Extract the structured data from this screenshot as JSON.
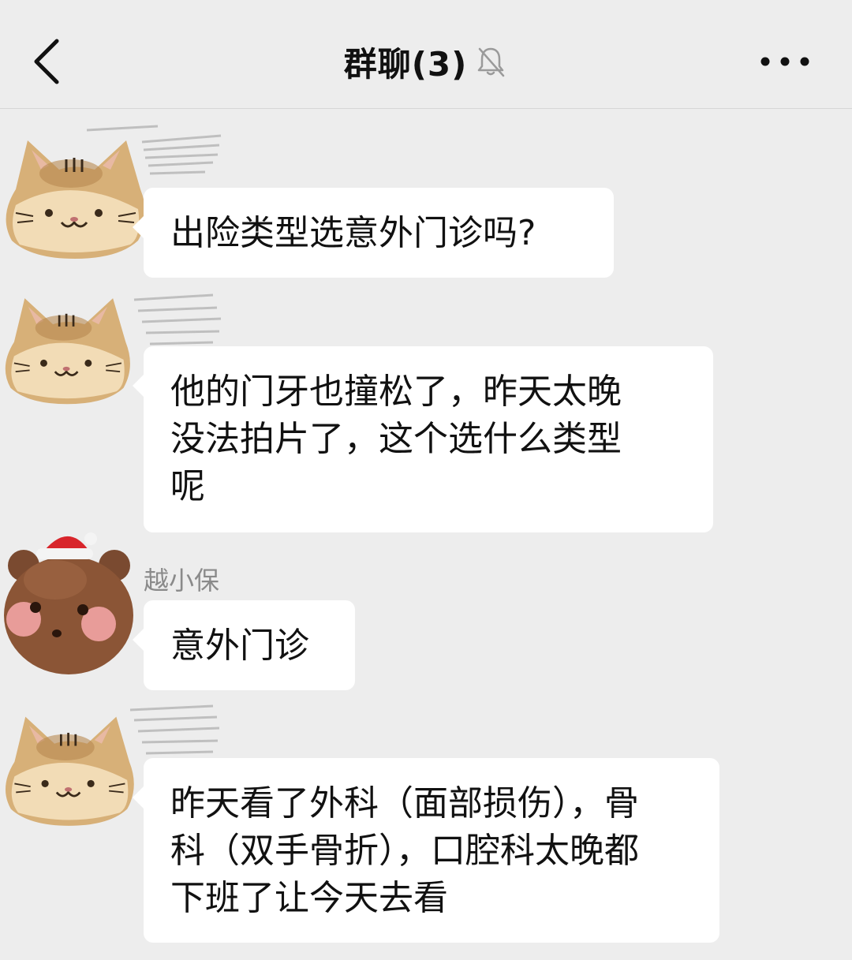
{
  "header": {
    "title": "群聊(3)",
    "back_icon": "chevron-left-icon",
    "mute_icon": "bell-off-icon",
    "more_icon": "more-dots-icon"
  },
  "messages": [
    {
      "sender": "",
      "avatar": "cat-bread-avatar",
      "text": "出险类型选意外门诊吗?"
    },
    {
      "sender": "",
      "avatar": "cat-bread-avatar",
      "text": "他的门牙也撞松了，昨天太晚\n没法拍片了，这个选什么类型\n呢"
    },
    {
      "sender": "越小保",
      "avatar": "bear-santa-hat-avatar",
      "text": "意外门诊"
    },
    {
      "sender": "",
      "avatar": "cat-bread-avatar",
      "text": "昨天看了外科（面部损伤），骨\n科（双手骨折），口腔科太晚都\n下班了让今天去看"
    }
  ],
  "colors": {
    "background": "#ededed",
    "bubble": "#ffffff",
    "text": "#111111",
    "sender_name": "#8a8a8a"
  }
}
